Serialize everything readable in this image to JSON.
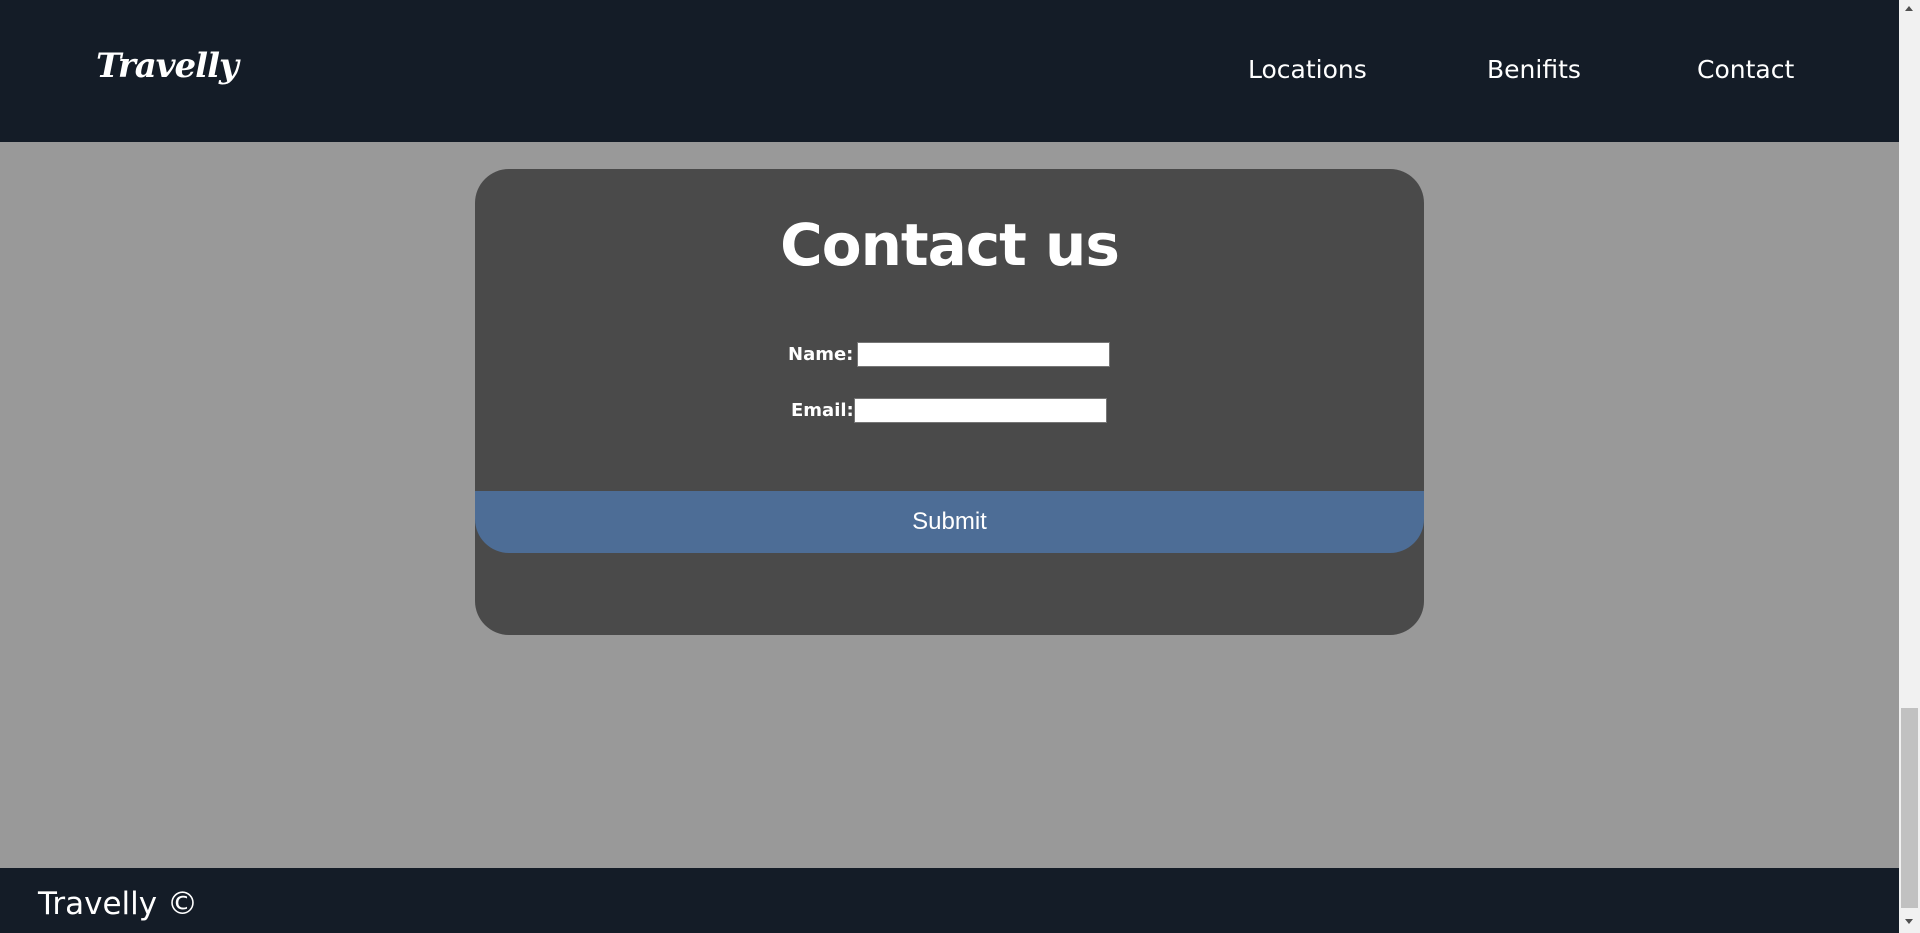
{
  "header": {
    "logo": "Travelly",
    "nav": {
      "locations": "Locations",
      "benefits": "Benifits",
      "contact": "Contact"
    }
  },
  "contact_form": {
    "title": "Contact us",
    "name_label": "Name:",
    "name_value": "",
    "email_label": "Email:",
    "email_value": "",
    "submit_label": "Submit"
  },
  "footer": {
    "text": "Travelly ©"
  },
  "colors": {
    "header_bg": "#141c27",
    "page_bg": "#999999",
    "card_bg": "#4a4a4a",
    "submit_bg": "#4d6d96",
    "text": "#ffffff"
  }
}
